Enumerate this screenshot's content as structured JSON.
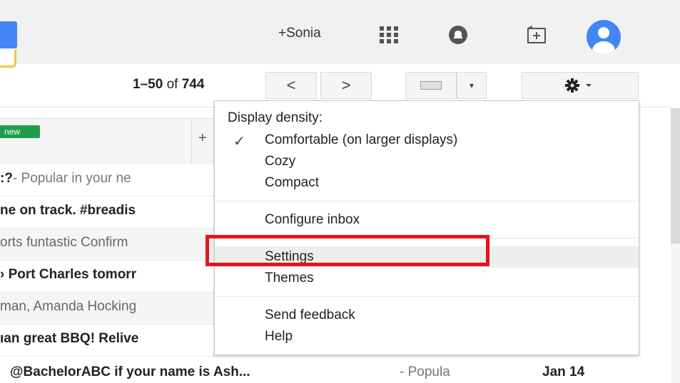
{
  "header": {
    "user_link": "+Sonia"
  },
  "toolbar": {
    "pager_range": "1–50",
    "pager_of": "of",
    "pager_total": "744",
    "prev_glyph": "<",
    "next_glyph": ">",
    "dropdown_glyph": "▾"
  },
  "inbox": {
    "new_badge": "new",
    "add_tab": "+",
    "rows": [
      {
        "subject": ":?",
        "snippet": " - Popular in your ne"
      },
      {
        "subject": "ne on track. #breadis",
        "snippet": ""
      },
      {
        "subject": "",
        "snippet": "orts funtastic Confirm"
      },
      {
        "subject": "› Port Charles tomorr",
        "snippet": ""
      },
      {
        "subject": "",
        "snippet": "man, Amanda Hocking"
      },
      {
        "subject": "ıan great BBQ! Relive",
        "snippet": ""
      }
    ],
    "last_row": {
      "subject": "@BachelorABC if your name is Ash...",
      "snippet": " - Popula",
      "date": "Jan 14"
    }
  },
  "menu": {
    "density_header": "Display density:",
    "checkmark": "✓",
    "comfortable": "Comfortable (on larger displays)",
    "cozy": "Cozy",
    "compact": "Compact",
    "configure_inbox": "Configure inbox",
    "settings": "Settings",
    "themes": "Themes",
    "send_feedback": "Send feedback",
    "help": "Help"
  },
  "colors": {
    "accent_blue": "#4285f4",
    "new_badge_green": "#1e9e4a",
    "highlight_red": "#e8121d"
  }
}
